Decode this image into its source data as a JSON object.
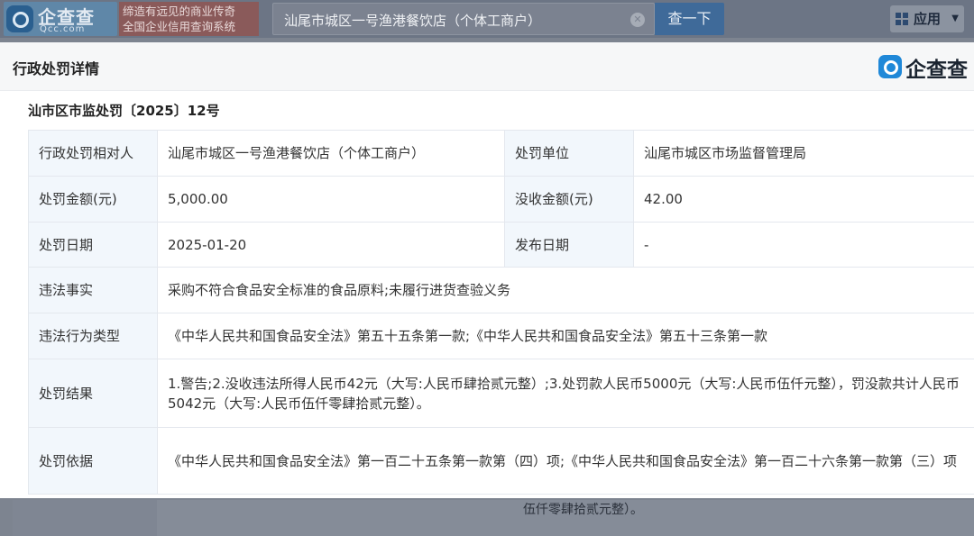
{
  "header": {
    "logo_text": "企查查",
    "logo_sub": "Qcc.com",
    "slogan_line1": "缔造有远见的商业传奇",
    "slogan_line2": "全国企业信用查询系统",
    "search_value": "汕尾市城区一号渔港餐饮店（个体工商户）",
    "search_button": "查一下",
    "apps_label": "应用"
  },
  "modal": {
    "title": "行政处罚详情",
    "brand": "企查查",
    "case_number": "汕市区市监处罚〔2025〕12号",
    "rows": {
      "party_label": "行政处罚相对人",
      "party_value": "汕尾市城区一号渔港餐饮店（个体工商户）",
      "unit_label": "处罚单位",
      "unit_value": "汕尾市城区市场监督管理局",
      "amount_label": "处罚金额(元)",
      "amount_value": "5,000.00",
      "confiscate_label": "没收金额(元)",
      "confiscate_value": "42.00",
      "date_label": "处罚日期",
      "date_value": "2025-01-20",
      "publish_label": "发布日期",
      "publish_value": "-",
      "facts_label": "违法事实",
      "facts_value": "采购不符合食品安全标准的食品原料;未履行进货查验义务",
      "type_label": "违法行为类型",
      "type_value": "《中华人民共和国食品安全法》第五十五条第一款;《中华人民共和国食品安全法》第五十三条第一款",
      "result_label": "处罚结果",
      "result_value": "1.警告;2.没收违法所得人民币42元（大写:人民币肆拾贰元整）;3.处罚款人民币5000元（大写:人民币伍仟元整），罚没款共计人民币5042元（大写:人民币伍仟零肆拾贰元整）。",
      "basis_label": "处罚依据",
      "basis_value": "《中华人民共和国食品安全法》第一百二十五条第一款第（四）项;《中华人民共和国食品安全法》第一百二十六条第一款第（三）项"
    }
  },
  "background": {
    "peek_text": "伍仟零肆拾贰元整）。"
  },
  "colors": {
    "link": "#1f6fc5",
    "label_bg": "#f2f7fc",
    "search_button": "#3f6a99"
  }
}
